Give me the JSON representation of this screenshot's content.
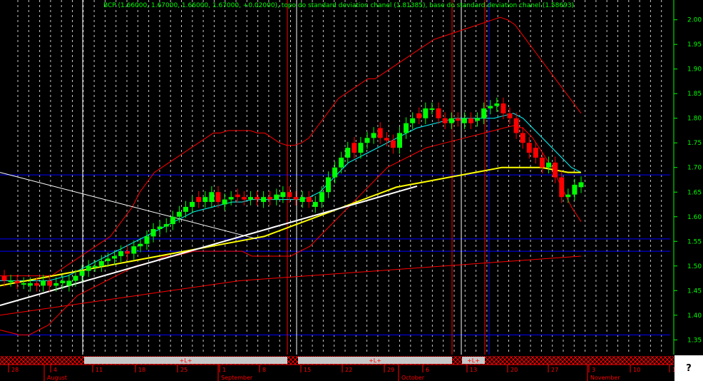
{
  "header": {
    "title": "BCP (1.66000, 1.67000, 1.66000, 1.67000, +0.02000), topo do standard deviation chanel (1.81385), base do standard deviation chanel (1.58693)"
  },
  "help_button": "?",
  "colors": {
    "background": "#000000",
    "axis": "#00ff00",
    "grid": "#c8c8c8",
    "candle_up": "#00ff00",
    "candle_down": "#ff0000",
    "bollinger": "#ff0000",
    "ma_long": "#ffff00",
    "ma_short_1": "#00ff00",
    "ma_short_2": "#00ffff",
    "channel_lines": "#0000ff",
    "vertical_markers": "#ff0000",
    "trendline": "#ffffff"
  },
  "chart_data": {
    "type": "candlestick",
    "series_name": "BCP",
    "ylim": [
      1.32,
      2.03
    ],
    "y_ticks": [
      "2.00",
      "1.95",
      "1.90",
      "1.85",
      "1.80",
      "1.75",
      "1.70",
      "1.65",
      "1.60",
      "1.55",
      "1.50",
      "1.45",
      "1.40",
      "1.35"
    ],
    "x_day_labels": [
      "28",
      "4",
      "11",
      "18",
      "25",
      "1",
      "8",
      "15",
      "22",
      "29",
      "6",
      "13",
      "20",
      "27",
      "3",
      "10",
      "1"
    ],
    "x_month_labels": [
      "August",
      "September",
      "October",
      "November"
    ],
    "signal_markers": [
      "+L+",
      "+L+",
      "+L+"
    ],
    "horizontal_levels": [
      1.685,
      1.555,
      1.53,
      1.36
    ],
    "close": [
      1.47,
      1.47,
      1.465,
      1.465,
      1.465,
      1.46,
      1.47,
      1.46,
      1.465,
      1.47,
      1.47,
      1.48,
      1.49,
      1.5,
      1.5,
      1.51,
      1.515,
      1.52,
      1.53,
      1.525,
      1.54,
      1.545,
      1.56,
      1.575,
      1.58,
      1.585,
      1.6,
      1.61,
      1.62,
      1.63,
      1.63,
      1.64,
      1.65,
      1.63,
      1.635,
      1.64,
      1.64,
      1.635,
      1.64,
      1.635,
      1.64,
      1.635,
      1.645,
      1.65,
      1.64,
      1.635,
      1.64,
      1.63,
      1.63,
      1.65,
      1.68,
      1.7,
      1.72,
      1.74,
      1.73,
      1.75,
      1.76,
      1.77,
      1.76,
      1.755,
      1.74,
      1.77,
      1.79,
      1.8,
      1.8,
      1.82,
      1.82,
      1.8,
      1.79,
      1.8,
      1.795,
      1.8,
      1.79,
      1.8,
      1.82,
      1.825,
      1.83,
      1.81,
      1.8,
      1.77,
      1.75,
      1.73,
      1.72,
      1.7,
      1.71,
      1.68,
      1.64,
      1.645,
      1.665,
      1.67
    ],
    "open": [
      1.48,
      1.47,
      1.47,
      1.465,
      1.46,
      1.465,
      1.46,
      1.47,
      1.46,
      1.465,
      1.46,
      1.47,
      1.48,
      1.49,
      1.5,
      1.5,
      1.51,
      1.515,
      1.52,
      1.53,
      1.525,
      1.54,
      1.545,
      1.56,
      1.575,
      1.58,
      1.585,
      1.6,
      1.61,
      1.62,
      1.64,
      1.63,
      1.63,
      1.65,
      1.625,
      1.635,
      1.645,
      1.64,
      1.635,
      1.64,
      1.63,
      1.64,
      1.635,
      1.64,
      1.65,
      1.64,
      1.63,
      1.64,
      1.62,
      1.63,
      1.65,
      1.68,
      1.7,
      1.72,
      1.75,
      1.73,
      1.75,
      1.76,
      1.78,
      1.76,
      1.755,
      1.74,
      1.77,
      1.79,
      1.81,
      1.8,
      1.82,
      1.82,
      1.8,
      1.79,
      1.8,
      1.79,
      1.8,
      1.795,
      1.8,
      1.82,
      1.825,
      1.83,
      1.81,
      1.8,
      1.77,
      1.75,
      1.74,
      1.72,
      1.7,
      1.71,
      1.68,
      1.64,
      1.645,
      1.66
    ],
    "bollinger_upper": [
      1.48,
      1.48,
      1.48,
      1.48,
      1.48,
      1.48,
      1.48,
      1.48,
      1.49,
      1.5,
      1.51,
      1.52,
      1.53,
      1.54,
      1.55,
      1.56,
      1.58,
      1.6,
      1.62,
      1.65,
      1.67,
      1.69,
      1.7,
      1.71,
      1.72,
      1.73,
      1.74,
      1.75,
      1.76,
      1.77,
      1.77,
      1.775,
      1.775,
      1.775,
      1.775,
      1.77,
      1.77,
      1.76,
      1.75,
      1.745,
      1.745,
      1.75,
      1.76,
      1.78,
      1.8,
      1.82,
      1.84,
      1.85,
      1.86,
      1.87,
      1.88,
      1.88,
      1.89,
      1.9,
      1.91,
      1.92,
      1.93,
      1.94,
      1.95,
      1.96,
      1.965,
      1.97,
      1.975,
      1.98,
      1.985,
      1.99,
      1.995,
      2.0,
      2.005,
      2.0,
      1.99,
      1.97,
      1.95,
      1.93,
      1.91,
      1.89,
      1.87,
      1.85,
      1.83,
      1.81
    ],
    "bollinger_lower": [
      1.37,
      1.365,
      1.36,
      1.36,
      1.37,
      1.38,
      1.4,
      1.42,
      1.44,
      1.45,
      1.46,
      1.47,
      1.48,
      1.49,
      1.5,
      1.505,
      1.51,
      1.52,
      1.52,
      1.525,
      1.53,
      1.53,
      1.53,
      1.53,
      1.53,
      1.53,
      1.52,
      1.52,
      1.52,
      1.52,
      1.52,
      1.53,
      1.54,
      1.56,
      1.58,
      1.6,
      1.62,
      1.64,
      1.66,
      1.68,
      1.7,
      1.71,
      1.72,
      1.73,
      1.74,
      1.745,
      1.75,
      1.755,
      1.76,
      1.765,
      1.77,
      1.775,
      1.78,
      1.785,
      1.78,
      1.76,
      1.73,
      1.7,
      1.66,
      1.62,
      1.59
    ],
    "ma_long": [
      1.46,
      1.465,
      1.47,
      1.475,
      1.48,
      1.485,
      1.49,
      1.495,
      1.5,
      1.505,
      1.51,
      1.515,
      1.52,
      1.525,
      1.53,
      1.535,
      1.54,
      1.545,
      1.55,
      1.555,
      1.56,
      1.57,
      1.58,
      1.59,
      1.6,
      1.61,
      1.62,
      1.63,
      1.64,
      1.65,
      1.66,
      1.665,
      1.67,
      1.675,
      1.68,
      1.685,
      1.69,
      1.695,
      1.7,
      1.7,
      1.7,
      1.7,
      1.695,
      1.69,
      1.69
    ],
    "ma_short": [
      1.47,
      1.47,
      1.47,
      1.47,
      1.47,
      1.47,
      1.475,
      1.48,
      1.49,
      1.5,
      1.51,
      1.52,
      1.53,
      1.54,
      1.55,
      1.56,
      1.57,
      1.58,
      1.59,
      1.6,
      1.61,
      1.615,
      1.62,
      1.625,
      1.63,
      1.63,
      1.635,
      1.635,
      1.635,
      1.635,
      1.635,
      1.635,
      1.64,
      1.65,
      1.67,
      1.69,
      1.71,
      1.72,
      1.73,
      1.74,
      1.75,
      1.76,
      1.77,
      1.78,
      1.785,
      1.79,
      1.795,
      1.8,
      1.8,
      1.8,
      1.8,
      1.8,
      1.805,
      1.81,
      1.8,
      1.78,
      1.76,
      1.74,
      1.72,
      1.7,
      1.69
    ],
    "long_trend_lower": [
      1.4,
      1.41,
      1.42,
      1.43,
      1.44,
      1.45,
      1.46,
      1.47,
      1.475,
      1.48,
      1.485,
      1.49,
      1.495,
      1.5,
      1.505,
      1.51,
      1.515,
      1.52
    ]
  }
}
